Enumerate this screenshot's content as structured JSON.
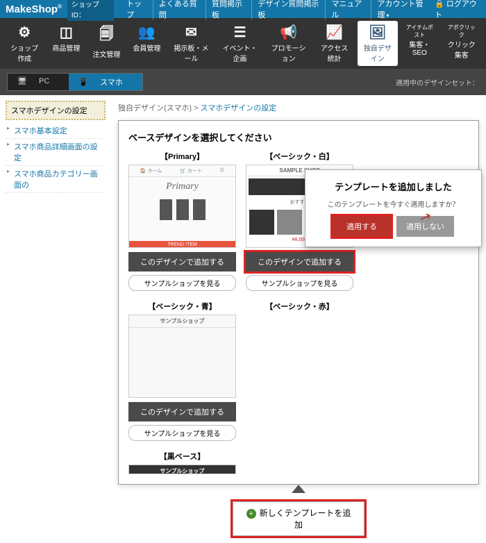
{
  "topbar": {
    "brand": "MakeShop",
    "shopid_label": "ショップID：",
    "logout": "ログアウト",
    "links": [
      "トップ",
      "よくある質問",
      "質問掲示板",
      "デザイン質問掲示板",
      "マニュアル",
      "アカウント管理"
    ]
  },
  "nav": [
    {
      "label": "ショップ作成",
      "icon": "⚙"
    },
    {
      "label": "商品管理",
      "icon": "◫"
    },
    {
      "label": "注文管理",
      "icon": "🗐"
    },
    {
      "label": "会員管理",
      "icon": "👥"
    },
    {
      "label": "掲示板・メール",
      "icon": "✉"
    },
    {
      "label": "イベント・企画",
      "icon": "☰"
    },
    {
      "label": "プロモーション",
      "icon": "📢"
    },
    {
      "label": "アクセス統計",
      "icon": "📈"
    },
    {
      "label": "独自デザイン",
      "icon": "🖼",
      "active": true
    },
    {
      "label": "集客・SEO",
      "sup": "アイテムポスト"
    },
    {
      "label": "クリック集客",
      "sup": "アポクリック"
    }
  ],
  "subbar": {
    "pc": "PC",
    "sp": "スマホ",
    "designset": "適用中のデザインセット："
  },
  "sidebar": {
    "title": "スマホデザインの設定",
    "items": [
      "スマホ基本設定",
      "スマホ商品詳細画面の設定",
      "スマホ商品カテゴリー画面の"
    ]
  },
  "breadcrumb": {
    "a": "独自デザイン(スマホ)",
    "b": "スマホデザインの設定"
  },
  "panel_title": "ベースデザインを選択してください",
  "themes": [
    {
      "title": "【Primary】",
      "add": "このデザインで追加する",
      "sample": "サンプルショップを見る",
      "thumb_logo": "Primary",
      "thumb_trend": "TREND ITEM",
      "thumb_home": "ホーム",
      "thumb_cart": "カート"
    },
    {
      "title": "【ベーシック・白】",
      "add": "このデザインで追加する",
      "sample": "サンプルショップを見る",
      "thumb_sample": "SAMPLE SHOP",
      "thumb_osusume": "おすすめ",
      "hl": true
    },
    {
      "title": "【ベーシック・青】",
      "add": "このデザインで追加する",
      "sample": "サンプルショップを見る",
      "thumb_sample": "サンプルショップ"
    },
    {
      "title": "【ベーシック・赤】"
    },
    {
      "title": "【黒ベース】",
      "thumb_sample": "サンプルショップ"
    }
  ],
  "popup": {
    "title": "テンプレートを追加しました",
    "msg": "このテンプレートを今すぐ適用しますか？",
    "apply": "適用する",
    "no": "適用しない"
  },
  "bottom_add": "新しくテンプレートを追加"
}
